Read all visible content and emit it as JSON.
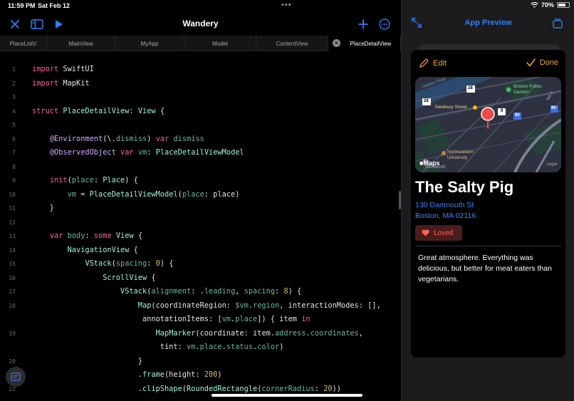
{
  "status_bar": {
    "time": "11:59 PM",
    "date": "Sat Feb 12",
    "battery": "70%",
    "battery_level": 0.7
  },
  "toolbar": {
    "title": "Wandery",
    "close_icon": "xmark-icon",
    "sidebar_icon": "sidebar-icon",
    "run_icon": "play-icon",
    "add_icon": "plus-icon",
    "more_icon": "ellipsis-circle-icon"
  },
  "tabs": [
    {
      "label": "PlaceListV",
      "active": false
    },
    {
      "label": "MainView",
      "active": false
    },
    {
      "label": "MyApp",
      "active": false
    },
    {
      "label": "Model",
      "active": false
    },
    {
      "label": "ContentView",
      "active": false
    },
    {
      "label": "PlaceDetailView",
      "active": true
    }
  ],
  "code_lines": [
    {
      "n": "1",
      "tokens": [
        [
          "import",
          "kw"
        ],
        [
          " SwiftUI",
          "pl"
        ]
      ]
    },
    {
      "n": "2",
      "tokens": [
        [
          "import",
          "kw"
        ],
        [
          " MapKit",
          "pl"
        ]
      ]
    },
    {
      "n": "3",
      "tokens": []
    },
    {
      "n": "4",
      "tokens": [
        [
          "struct",
          "kw"
        ],
        [
          " ",
          "pl"
        ],
        [
          "PlaceDetailView",
          "ty"
        ],
        [
          ": ",
          "pl"
        ],
        [
          "View",
          "ty"
        ],
        [
          " {",
          "pl"
        ]
      ]
    },
    {
      "n": "5",
      "tokens": []
    },
    {
      "n": "6",
      "tokens": [
        [
          "    ",
          "pl"
        ],
        [
          "@Environment",
          "at"
        ],
        [
          "(\\.",
          "pl"
        ],
        [
          "dismiss",
          "id"
        ],
        [
          ") ",
          "pl"
        ],
        [
          "var",
          "kw"
        ],
        [
          " ",
          "pl"
        ],
        [
          "dismiss",
          "id"
        ]
      ]
    },
    {
      "n": "7",
      "tokens": [
        [
          "    ",
          "pl"
        ],
        [
          "@ObservedObject",
          "at"
        ],
        [
          " ",
          "pl"
        ],
        [
          "var",
          "kw"
        ],
        [
          " ",
          "pl"
        ],
        [
          "vm",
          "id"
        ],
        [
          ": ",
          "pl"
        ],
        [
          "PlaceDetailViewModel",
          "ty"
        ]
      ]
    },
    {
      "n": "8",
      "tokens": []
    },
    {
      "n": "9",
      "tokens": [
        [
          "    ",
          "pl"
        ],
        [
          "init",
          "kw"
        ],
        [
          "(",
          "pl"
        ],
        [
          "place",
          "id"
        ],
        [
          ": ",
          "pl"
        ],
        [
          "Place",
          "ty"
        ],
        [
          ") {",
          "pl"
        ]
      ]
    },
    {
      "n": "10",
      "tokens": [
        [
          "        ",
          "pl"
        ],
        [
          "vm",
          "id"
        ],
        [
          " = ",
          "pl"
        ],
        [
          "PlaceDetailViewModel",
          "ty"
        ],
        [
          "(",
          "pl"
        ],
        [
          "place",
          "id"
        ],
        [
          ": place)",
          "pl"
        ]
      ]
    },
    {
      "n": "11",
      "tokens": [
        [
          "    }",
          "pl"
        ]
      ]
    },
    {
      "n": "12",
      "tokens": []
    },
    {
      "n": "13",
      "tokens": [
        [
          "    ",
          "pl"
        ],
        [
          "var",
          "kw"
        ],
        [
          " ",
          "pl"
        ],
        [
          "body",
          "id"
        ],
        [
          ": ",
          "pl"
        ],
        [
          "some",
          "kw"
        ],
        [
          " ",
          "pl"
        ],
        [
          "View",
          "ty"
        ],
        [
          " {",
          "pl"
        ]
      ]
    },
    {
      "n": "14",
      "tokens": [
        [
          "        ",
          "pl"
        ],
        [
          "NavigationView",
          "ty"
        ],
        [
          " {",
          "pl"
        ]
      ]
    },
    {
      "n": "15",
      "tokens": [
        [
          "            ",
          "pl"
        ],
        [
          "VStack",
          "ty"
        ],
        [
          "(",
          "pl"
        ],
        [
          "spacing",
          "id"
        ],
        [
          ": ",
          "pl"
        ],
        [
          "0",
          "nu"
        ],
        [
          ") {",
          "pl"
        ]
      ]
    },
    {
      "n": "16",
      "tokens": [
        [
          "                ",
          "pl"
        ],
        [
          "ScrollView",
          "ty"
        ],
        [
          " {",
          "pl"
        ]
      ]
    },
    {
      "n": "17",
      "tokens": [
        [
          "                    ",
          "pl"
        ],
        [
          "VStack",
          "ty"
        ],
        [
          "(",
          "pl"
        ],
        [
          "alignment",
          "id"
        ],
        [
          ": .",
          "pl"
        ],
        [
          "leading",
          "id"
        ],
        [
          ", ",
          "pl"
        ],
        [
          "spacing",
          "id"
        ],
        [
          ": ",
          "pl"
        ],
        [
          "8",
          "nu"
        ],
        [
          ") {",
          "pl"
        ]
      ]
    },
    {
      "n": "18",
      "tokens": [
        [
          "                        ",
          "pl"
        ],
        [
          "Map",
          "ty"
        ],
        [
          "(coordinateRegion: ",
          "pl"
        ],
        [
          "$vm",
          "id"
        ],
        [
          ".",
          "pl"
        ],
        [
          "region",
          "id"
        ],
        [
          ", interactionModes: [],",
          "pl"
        ]
      ]
    },
    {
      "n": "",
      "tokens": [
        [
          "                         annotationItems: [",
          "pl"
        ],
        [
          "vm",
          "id"
        ],
        [
          ".",
          "pl"
        ],
        [
          "place",
          "id"
        ],
        [
          "]) { item ",
          "pl"
        ],
        [
          "in",
          "kw"
        ]
      ]
    },
    {
      "n": "19",
      "tokens": [
        [
          "                            ",
          "pl"
        ],
        [
          "MapMarker",
          "ty"
        ],
        [
          "(coordinate: item.",
          "pl"
        ],
        [
          "address",
          "id"
        ],
        [
          ".",
          "pl"
        ],
        [
          "coordinates",
          "id"
        ],
        [
          ",",
          "pl"
        ]
      ]
    },
    {
      "n": "",
      "tokens": [
        [
          "                             tint: ",
          "pl"
        ],
        [
          "vm",
          "id"
        ],
        [
          ".",
          "pl"
        ],
        [
          "place",
          "id"
        ],
        [
          ".",
          "pl"
        ],
        [
          "status",
          "id"
        ],
        [
          ".",
          "pl"
        ],
        [
          "color",
          "id"
        ],
        [
          ")",
          "pl"
        ]
      ]
    },
    {
      "n": "20",
      "tokens": [
        [
          "                        }",
          "pl"
        ]
      ]
    },
    {
      "n": "21",
      "tokens": [
        [
          "                        .",
          "pl"
        ],
        [
          "frame",
          "ty"
        ],
        [
          "(height: ",
          "pl"
        ],
        [
          "200",
          "nu"
        ],
        [
          ")",
          "pl"
        ]
      ]
    },
    {
      "n": "22",
      "tokens": [
        [
          "                        .",
          "pl"
        ],
        [
          "clipShape",
          "ty"
        ],
        [
          "(",
          "pl"
        ],
        [
          "RoundedRectangle",
          "ty"
        ],
        [
          "(",
          "pl"
        ],
        [
          "cornerRadius",
          "id"
        ],
        [
          ": ",
          "pl"
        ],
        [
          "20",
          "nu"
        ],
        [
          "))",
          "pl"
        ]
      ]
    }
  ],
  "syntax_colors": {
    "kw": "#fc5fa3",
    "ty": "#9ef1dd",
    "id": "#67b7a4",
    "at": "#d0a8ff",
    "nu": "#d0bf69",
    "pl": "#e5e5e5"
  },
  "preview": {
    "title": "App Preview",
    "edit_label": "Edit",
    "done_label": "Done",
    "place_name": "The Salty Pig",
    "address_line1": "130 Dartmouth St",
    "address_line2": "Boston, MA 02116",
    "loved_label": "Loved",
    "description": "Great atmosphere. Everything was delicious, but better for meat eaters than vegetarians.",
    "map": {
      "maps_label": "Maps",
      "legal_label": "Legal",
      "labels": {
        "newbury": "Newbury Street",
        "boston_public": "Boston Public",
        "garden": "Garden",
        "northeastern": "Northeastern",
        "university": "University",
        "wentworth": "Wentworth",
        "charles": "Charles River",
        "ma": "MA-3",
        "r28a": "28",
        "r28b": "28",
        "r9": "9",
        "r90a": "90",
        "r90b": "90"
      }
    },
    "accent": "#f6a623",
    "link_color": "#3a82f7",
    "loved_color": "#ff6259"
  }
}
